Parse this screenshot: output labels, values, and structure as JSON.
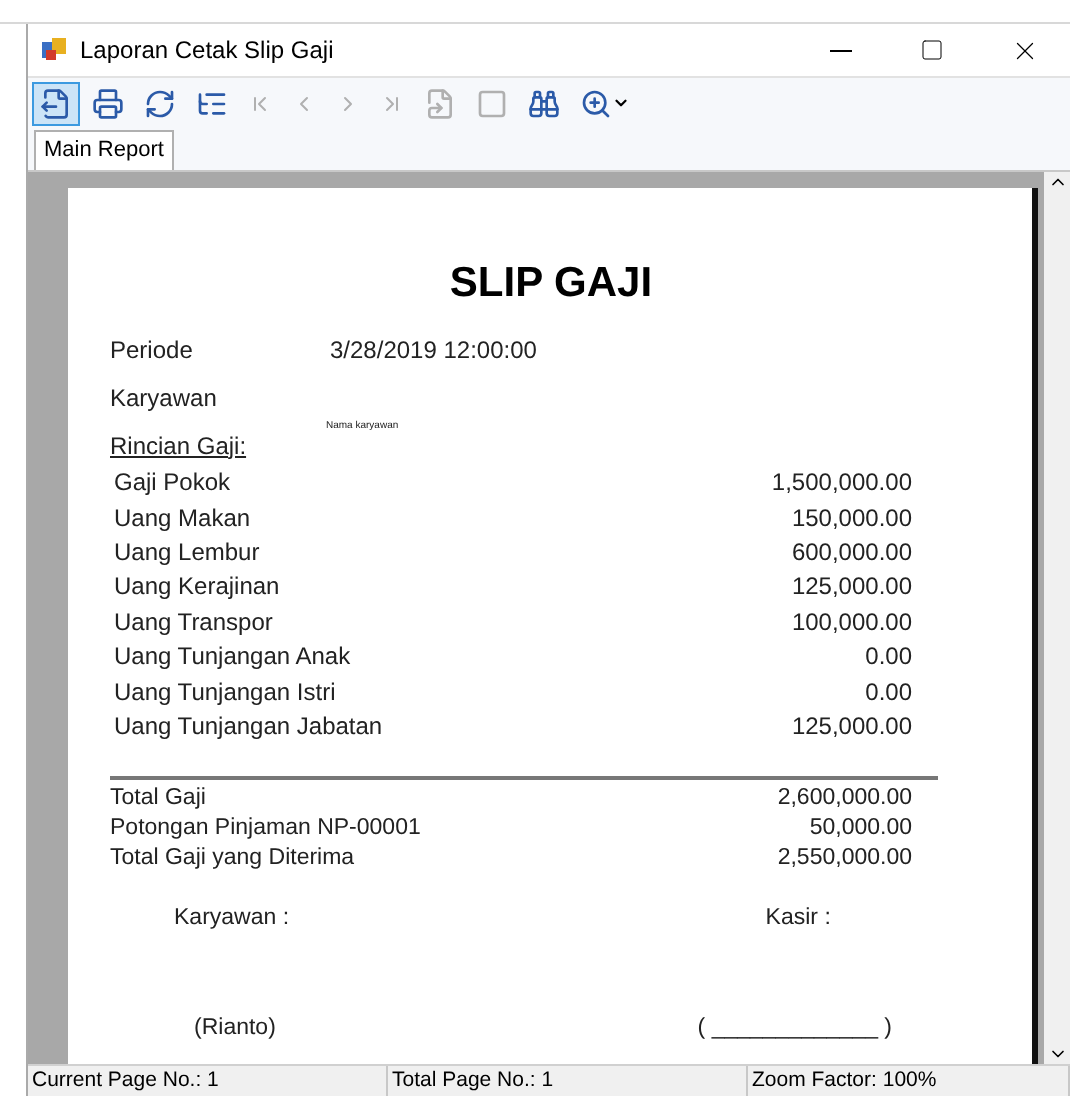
{
  "window": {
    "title": "Laporan Cetak Slip Gaji"
  },
  "toolbar": [
    {
      "kind": "export",
      "disabled": false,
      "selected": true
    },
    {
      "kind": "print",
      "disabled": false,
      "selected": false
    },
    {
      "kind": "refresh",
      "disabled": false,
      "selected": false
    },
    {
      "kind": "tree",
      "disabled": false,
      "selected": false
    },
    {
      "kind": "first",
      "disabled": true,
      "selected": false
    },
    {
      "kind": "prev",
      "disabled": true,
      "selected": false
    },
    {
      "kind": "next",
      "disabled": true,
      "selected": false
    },
    {
      "kind": "last",
      "disabled": true,
      "selected": false
    },
    {
      "kind": "goto",
      "disabled": true,
      "selected": false
    },
    {
      "kind": "stop",
      "disabled": true,
      "selected": false
    },
    {
      "kind": "find",
      "disabled": false,
      "selected": false
    },
    {
      "kind": "zoom",
      "disabled": false,
      "selected": false
    }
  ],
  "tabs": [
    {
      "label": "Main Report",
      "selected": true
    }
  ],
  "report": {
    "title": "SLIP GAJI",
    "period_label": "Periode",
    "period_value": "3/28/2019  12:00:00",
    "employee_label": "Karyawan",
    "employee_name": "Nama karyawan",
    "details_heading": "Rincian Gaji:",
    "items": [
      {
        "label": "Gaji Pokok",
        "amount": "1,500,000.00"
      },
      {
        "label": "Uang Makan",
        "amount": "150,000.00"
      },
      {
        "label": "Uang Lembur",
        "amount": "600,000.00"
      },
      {
        "label": "Uang Kerajinan",
        "amount": "125,000.00"
      },
      {
        "label": "Uang Transpor",
        "amount": "100,000.00"
      },
      {
        "label": "Uang Tunjangan Anak",
        "amount": "0.00"
      },
      {
        "label": "Uang Tunjangan Istri",
        "amount": "0.00"
      },
      {
        "label": "Uang Tunjangan Jabatan",
        "amount": "125,000.00"
      }
    ],
    "totals": [
      {
        "label": "Total Gaji",
        "amount": "2,600,000.00"
      },
      {
        "label": "Potongan Pinjaman NP-00001",
        "amount": "50,000.00"
      },
      {
        "label": "Total Gaji yang Diterima",
        "amount": "2,550,000.00"
      }
    ],
    "signatures": [
      {
        "label": "Karyawan :",
        "name": "(Rianto)"
      },
      {
        "label": "Kasir :",
        "name": "( _____________ )"
      }
    ]
  },
  "status_bar": [
    "Current Page No.: 1",
    "Total Page No.: 1",
    "Zoom Factor: 100%"
  ]
}
